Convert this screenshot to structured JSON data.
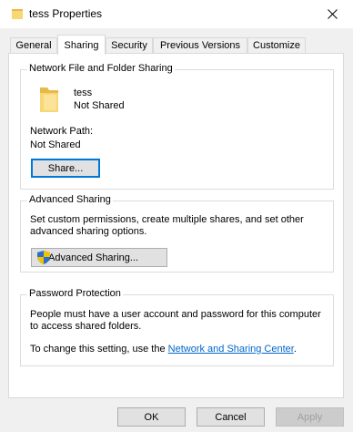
{
  "window": {
    "title": "tess Properties",
    "icon": "folder-icon",
    "close_icon": "close-icon"
  },
  "tabs": [
    {
      "label": "General",
      "active": false
    },
    {
      "label": "Sharing",
      "active": true
    },
    {
      "label": "Security",
      "active": false
    },
    {
      "label": "Previous Versions",
      "active": false
    },
    {
      "label": "Customize",
      "active": false
    }
  ],
  "network_sharing": {
    "legend": "Network File and Folder Sharing",
    "folder_name": "tess",
    "status": "Not Shared",
    "network_path_label": "Network Path:",
    "network_path_value": "Not Shared",
    "share_button": "Share..."
  },
  "advanced_sharing": {
    "legend": "Advanced Sharing",
    "description": "Set custom permissions, create multiple shares, and set other advanced sharing options.",
    "button": "Advanced Sharing...",
    "button_icon": "uac-shield-icon"
  },
  "password_protection": {
    "legend": "Password Protection",
    "description": "People must have a user account and password for this computer to access shared folders.",
    "change_prefix": "To change this setting, use the ",
    "link_text": "Network and Sharing Center",
    "change_suffix": "."
  },
  "footer": {
    "ok": "OK",
    "cancel": "Cancel",
    "apply": "Apply"
  },
  "colors": {
    "accent": "#0078d7",
    "link": "#0066cc",
    "folder": "#f8d775"
  }
}
